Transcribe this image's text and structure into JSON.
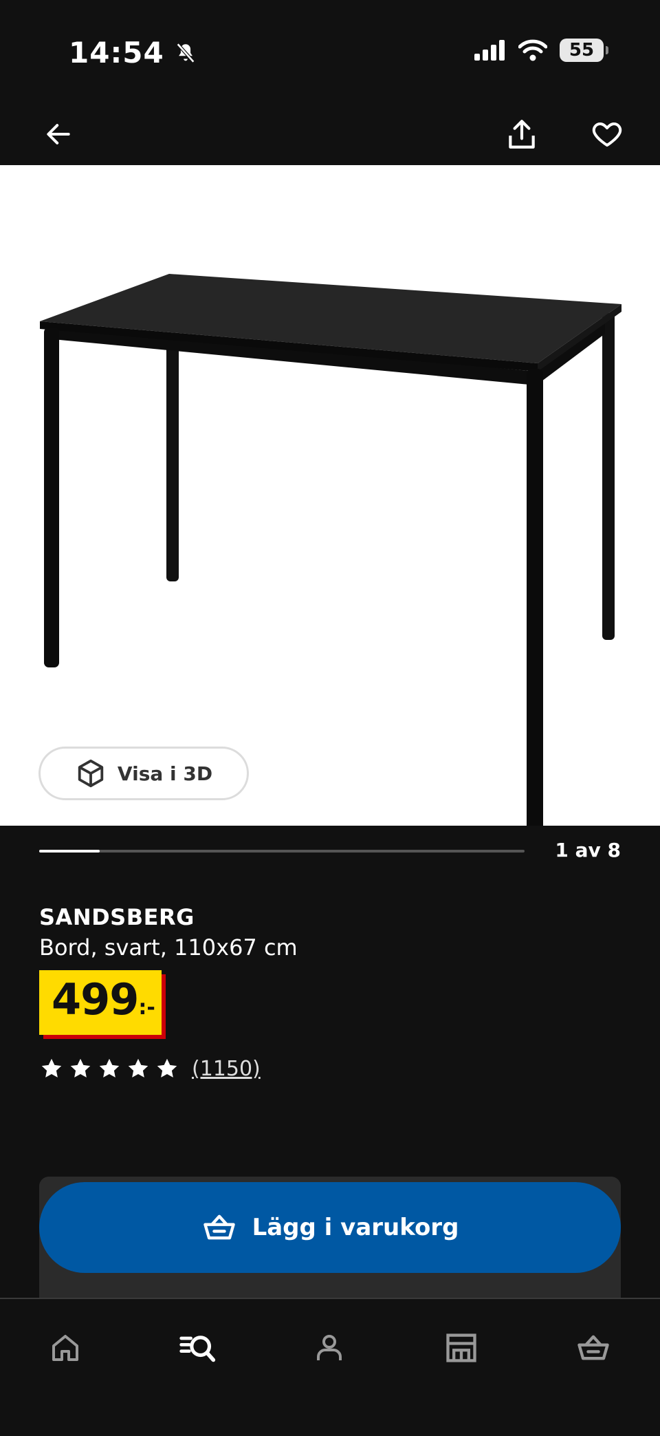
{
  "status_bar": {
    "time": "14:54",
    "battery": "55"
  },
  "product": {
    "name": "SANDSBERG",
    "description": "Bord, svart, 110x67 cm",
    "price_main": "499",
    "price_suffix": ":-",
    "review_count": "(1150)",
    "rating": 5,
    "rating_max": 5
  },
  "gallery": {
    "view_3d_label": "Visa i 3D",
    "counter": "1 av 8",
    "current": 1,
    "total": 8
  },
  "actions": {
    "add_to_cart_label": "Lägg i varukorg"
  },
  "tabs": [
    {
      "icon": "home-icon"
    },
    {
      "icon": "search-list-icon"
    },
    {
      "icon": "profile-icon"
    },
    {
      "icon": "store-icon"
    },
    {
      "icon": "cart-icon"
    }
  ],
  "colors": {
    "background": "#111111",
    "price_tag": "#ffdb00",
    "price_shadow": "#cc0008",
    "primary_button": "#0058a3"
  }
}
